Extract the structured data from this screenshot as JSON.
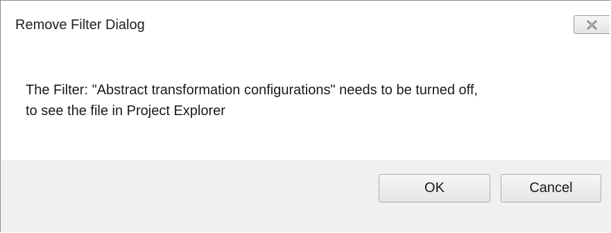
{
  "window": {
    "title": "Remove Filter Dialog",
    "close_icon": "close-icon"
  },
  "message": {
    "line1": "The Filter: \"Abstract transformation configurations\" needs to be turned off,",
    "line2": "to see the file in Project Explorer"
  },
  "buttons": {
    "ok_label": "OK",
    "cancel_label": "Cancel"
  },
  "colors": {
    "button_area_background": "#f0f0f0",
    "dialog_background": "#ffffff"
  }
}
